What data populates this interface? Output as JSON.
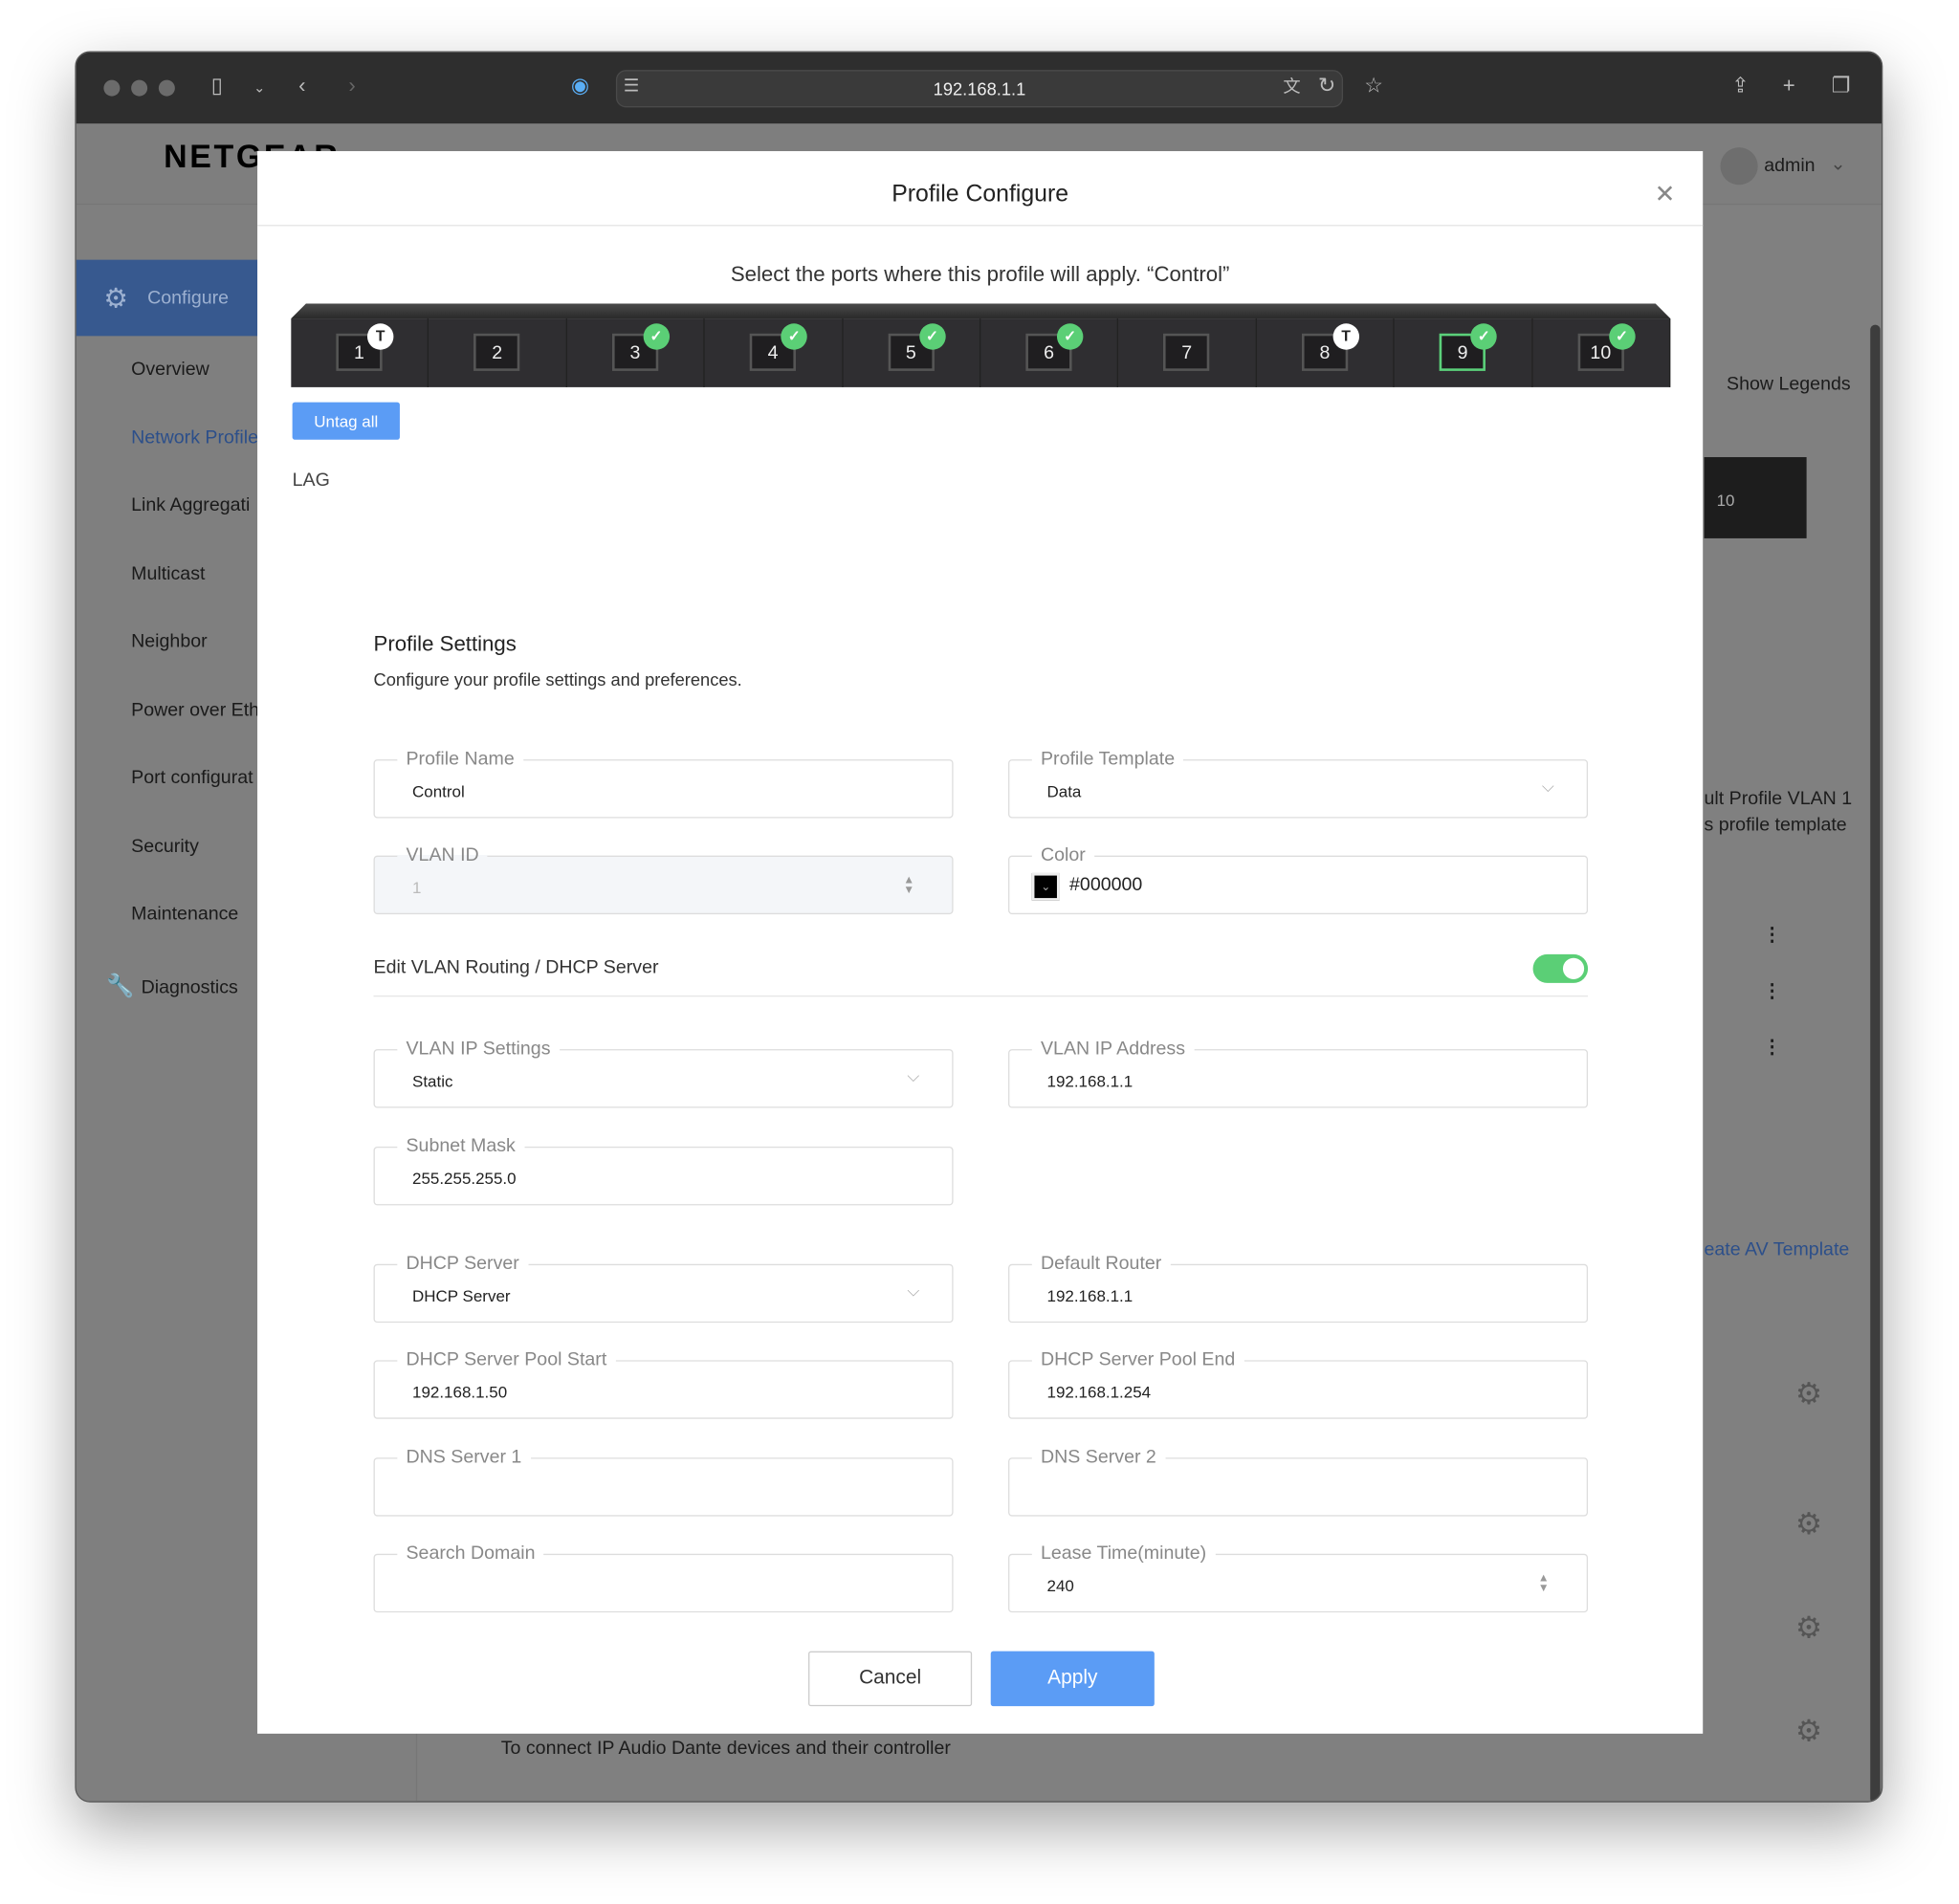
{
  "browser": {
    "url": "192.168.1.1"
  },
  "app": {
    "logo": "NETGEAR",
    "user": "admin",
    "sidebar": [
      {
        "label": "Configure"
      },
      {
        "label": "Overview"
      },
      {
        "label": "Network Profile"
      },
      {
        "label": "Link Aggregati"
      },
      {
        "label": "Multicast"
      },
      {
        "label": "Neighbor"
      },
      {
        "label": "Power over Eth"
      },
      {
        "label": "Port configurat"
      },
      {
        "label": "Security"
      },
      {
        "label": "Maintenance"
      },
      {
        "label": "Diagnostics"
      }
    ],
    "background": {
      "show_legends": "Show Legends",
      "port_10": "10",
      "tooltip_line1": "ult Profile VLAN 1",
      "tooltip_line2": "s profile template",
      "create_av": "eate AV Template",
      "footer_desc": "To connect IP Audio Dante devices and their controller"
    }
  },
  "modal": {
    "title": "Profile Configure",
    "subtitle": "Select the ports where this profile will apply. “Control”",
    "ports": [
      {
        "n": "1",
        "state": "tagged"
      },
      {
        "n": "2",
        "state": "none"
      },
      {
        "n": "3",
        "state": "untagged"
      },
      {
        "n": "4",
        "state": "untagged"
      },
      {
        "n": "5",
        "state": "untagged"
      },
      {
        "n": "6",
        "state": "untagged"
      },
      {
        "n": "7",
        "state": "none"
      },
      {
        "n": "8",
        "state": "tagged"
      },
      {
        "n": "9",
        "state": "untagged",
        "selected": true
      },
      {
        "n": "10",
        "state": "untagged"
      }
    ],
    "tag_letter": "T",
    "untag_all": "Untag all",
    "lag": "LAG",
    "settings_title": "Profile Settings",
    "settings_desc": "Configure your profile settings and preferences.",
    "fields": {
      "profile_name": {
        "label": "Profile Name",
        "value": "Control"
      },
      "profile_template": {
        "label": "Profile Template",
        "value": "Data"
      },
      "vlan_id": {
        "label": "VLAN ID",
        "value": "1"
      },
      "color": {
        "label": "Color",
        "value": "#000000"
      },
      "routing_toggle": {
        "label": "Edit VLAN Routing / DHCP Server",
        "on": true
      },
      "vlan_ip_settings": {
        "label": "VLAN IP Settings",
        "value": "Static"
      },
      "vlan_ip_address": {
        "label": "VLAN IP Address",
        "value": "192.168.1.1"
      },
      "subnet_mask": {
        "label": "Subnet Mask",
        "value": "255.255.255.0"
      },
      "dhcp_server": {
        "label": "DHCP Server",
        "value": "DHCP Server"
      },
      "default_router": {
        "label": "Default Router",
        "value": "192.168.1.1"
      },
      "pool_start": {
        "label": "DHCP Server Pool Start",
        "value": "192.168.1.50"
      },
      "pool_end": {
        "label": "DHCP Server Pool End",
        "value": "192.168.1.254"
      },
      "dns1": {
        "label": "DNS Server 1",
        "value": ""
      },
      "dns2": {
        "label": "DNS Server 2",
        "value": ""
      },
      "search_domain": {
        "label": "Search Domain",
        "value": ""
      },
      "lease_time": {
        "label": "Lease Time(minute)",
        "value": "240"
      }
    },
    "cancel": "Cancel",
    "apply": "Apply"
  },
  "colors": {
    "accent": "#5b9cf5",
    "success": "#5bcf76"
  }
}
